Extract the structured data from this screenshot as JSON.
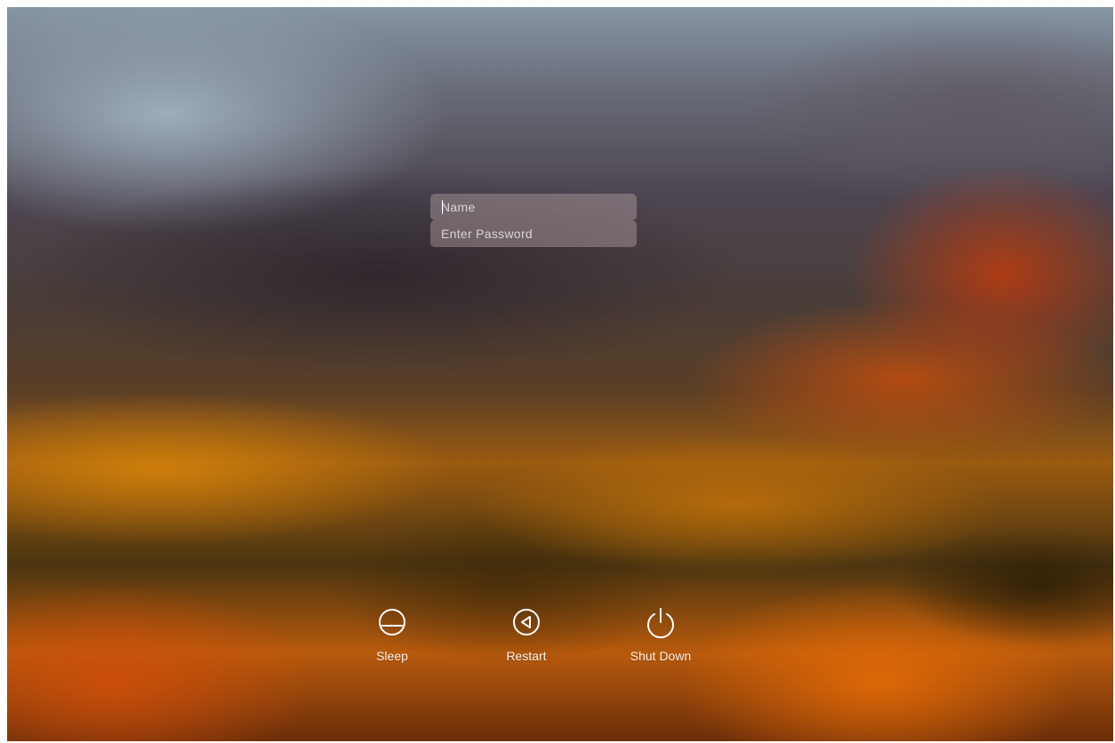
{
  "login": {
    "name_placeholder": "Name",
    "password_placeholder": "Enter Password",
    "name_value": "",
    "password_value": ""
  },
  "actions": [
    {
      "label": "Sleep",
      "icon": "sleep-icon"
    },
    {
      "label": "Restart",
      "icon": "restart-icon"
    },
    {
      "label": "Shut Down",
      "icon": "power-icon"
    }
  ],
  "colors": {
    "text": "#ffffff",
    "field_background": "#c8b4b4",
    "background_orange": "#d66a08",
    "background_blue_gray": "#8795a4"
  }
}
